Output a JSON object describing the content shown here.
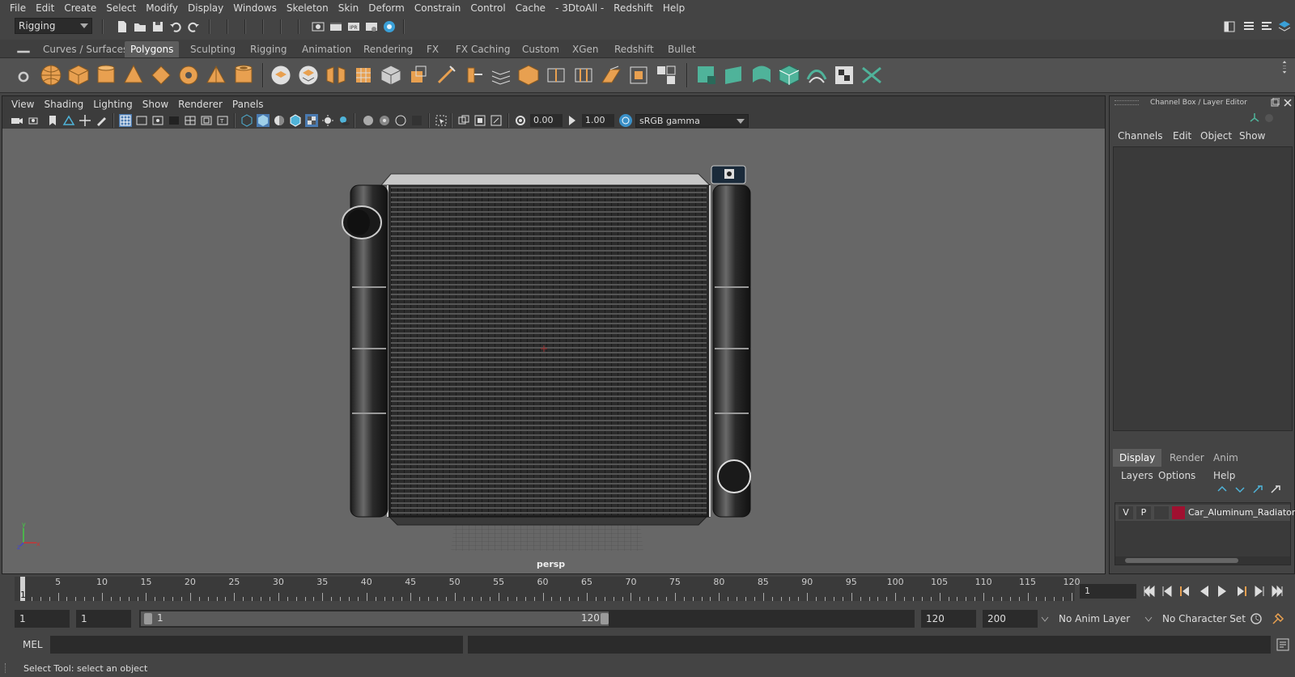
{
  "menubar": {
    "items": [
      "File",
      "Edit",
      "Create",
      "Select",
      "Modify",
      "Display",
      "Windows",
      "Skeleton",
      "Skin",
      "Deform",
      "Constrain",
      "Control",
      "Cache",
      "- 3DtoAll -",
      "Redshift",
      "Help"
    ]
  },
  "statusline": {
    "menuset": "Rigging"
  },
  "shelf": {
    "tabs": [
      "Curves / Surfaces",
      "Polygons",
      "Sculpting",
      "Rigging",
      "Animation",
      "Rendering",
      "FX",
      "FX Caching",
      "Custom",
      "XGen",
      "Redshift",
      "Bullet"
    ],
    "active_tab": "Polygons"
  },
  "viewport": {
    "menus": [
      "View",
      "Shading",
      "Lighting",
      "Show",
      "Renderer",
      "Panels"
    ],
    "exposure": "0.00",
    "gamma": "1.00",
    "color_space": "sRGB gamma",
    "camera": "persp"
  },
  "channelbox": {
    "title": "Channel Box / Layer Editor",
    "menus": [
      "Channels",
      "Edit",
      "Object",
      "Show"
    ],
    "layer_tabs": [
      "Display",
      "Render",
      "Anim"
    ],
    "active_layer_tab": "Display",
    "layer_menus": [
      "Layers",
      "Options",
      "Help"
    ],
    "layers": [
      {
        "visible": "V",
        "playback": "P",
        "name": "Car_Aluminum_Radiator",
        "color": "#a01030"
      }
    ]
  },
  "timeslider": {
    "ticks": [
      1,
      5,
      10,
      15,
      20,
      25,
      30,
      35,
      40,
      45,
      50,
      55,
      60,
      65,
      70,
      75,
      80,
      85,
      90,
      95,
      100,
      105,
      110,
      115,
      120
    ],
    "current_frame": "1"
  },
  "range": {
    "start": "1",
    "playback_start": "1",
    "slider_start": "1",
    "slider_end": "120",
    "playback_end": "120",
    "end": "200",
    "anim_layer": "No Anim Layer",
    "character_set": "No Character Set"
  },
  "commandline": {
    "label": "MEL"
  },
  "helpline": {
    "text": "Select Tool: select an object"
  },
  "colors": {
    "accent_teal": "#4fb39a",
    "shelf_orange": "#e8a050",
    "layer_color": "#a01030"
  }
}
